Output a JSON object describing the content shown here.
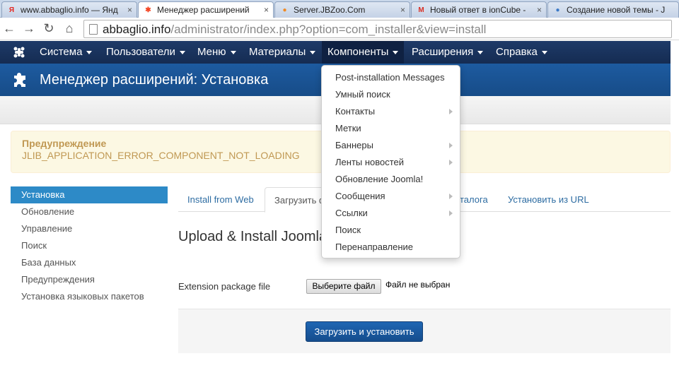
{
  "browser": {
    "tabs": [
      {
        "label": "www.abbaglio.info — Янд",
        "favicon": "Я",
        "favicon_color": "#e52620"
      },
      {
        "label": "Менеджер расширений",
        "favicon": "✱",
        "favicon_color": "#f44321"
      },
      {
        "label": "Server.JBZoo.Com",
        "favicon": "●",
        "favicon_color": "#f08a24"
      },
      {
        "label": "Новый ответ в ionCube -",
        "favicon": "M",
        "favicon_color": "#d93025"
      },
      {
        "label": "Создание новой темы - J",
        "favicon": "●",
        "favicon_color": "#3b79c7"
      }
    ],
    "close_glyph": "×",
    "url_host": "abbaglio.info",
    "url_path": "/administrator/index.php?option=com_installer&view=install"
  },
  "navbar": {
    "items": [
      {
        "label": "Система"
      },
      {
        "label": "Пользователи"
      },
      {
        "label": "Меню"
      },
      {
        "label": "Материалы"
      },
      {
        "label": "Компоненты"
      },
      {
        "label": "Расширения"
      },
      {
        "label": "Справка"
      }
    ]
  },
  "header": {
    "title": "Менеджер расширений: Установка"
  },
  "alert": {
    "heading": "Предупреждение",
    "message": "JLIB_APPLICATION_ERROR_COMPONENT_NOT_LOADING"
  },
  "sidebar": {
    "items": [
      {
        "label": "Установка"
      },
      {
        "label": "Обновление"
      },
      {
        "label": "Управление"
      },
      {
        "label": "Поиск"
      },
      {
        "label": "База данных"
      },
      {
        "label": "Предупреждения"
      },
      {
        "label": "Установка языковых пакетов"
      }
    ]
  },
  "tabs": {
    "items": [
      {
        "label": "Install from Web"
      },
      {
        "label": "Загрузить ф"
      },
      {
        "label": "талога"
      },
      {
        "label": "Установить из URL"
      }
    ]
  },
  "content": {
    "title": "Upload & Install Joomla",
    "field_label": "Extension package file",
    "file_button": "Выберите файл",
    "file_status": "Файл не выбран",
    "submit": "Загрузить и установить"
  },
  "dropdown": {
    "items": [
      {
        "label": "Post-installation Messages",
        "sub": false
      },
      {
        "label": "Умный поиск",
        "sub": false
      },
      {
        "label": "Контакты",
        "sub": true
      },
      {
        "label": "Метки",
        "sub": false
      },
      {
        "label": "Баннеры",
        "sub": true
      },
      {
        "label": "Ленты новостей",
        "sub": true
      },
      {
        "label": "Обновление Joomla!",
        "sub": false
      },
      {
        "label": "Сообщения",
        "sub": true
      },
      {
        "label": "Ссылки",
        "sub": true
      },
      {
        "label": "Поиск",
        "sub": false
      },
      {
        "label": "Перенаправление",
        "sub": false
      }
    ]
  },
  "colors": {
    "navbar": "#1e3a68",
    "header": "#1d5ba0",
    "sidebar_active": "#2d8ac7",
    "alert_text": "#c09853",
    "primary_button": "#1f66b3"
  }
}
